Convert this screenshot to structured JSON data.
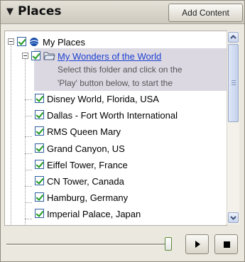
{
  "header": {
    "title": "Places",
    "collapse_glyph": "▼",
    "add_content_label": "Add Content"
  },
  "tree": {
    "root": {
      "label": "My Places",
      "icon": "globe-icon"
    },
    "folder": {
      "label": "My Wonders of the World",
      "icon": "folder-open-icon",
      "description_line1": "Select this folder and click on the",
      "description_line2": "'Play' button below, to start the"
    },
    "items": [
      "Disney World, Florida, USA",
      "Dallas - Fort Worth International",
      "RMS Queen Mary",
      "Grand Canyon, US",
      "Eiffel Tower, France",
      "CN Tower, Canada",
      "Hamburg, Germany",
      "Imperial Palace, Japan"
    ]
  },
  "colors": {
    "link": "#1d3fd0",
    "checkmark": "#1f9a1f",
    "selection": "#dbd8e2"
  },
  "playback": {
    "slider_level": 1.0
  }
}
